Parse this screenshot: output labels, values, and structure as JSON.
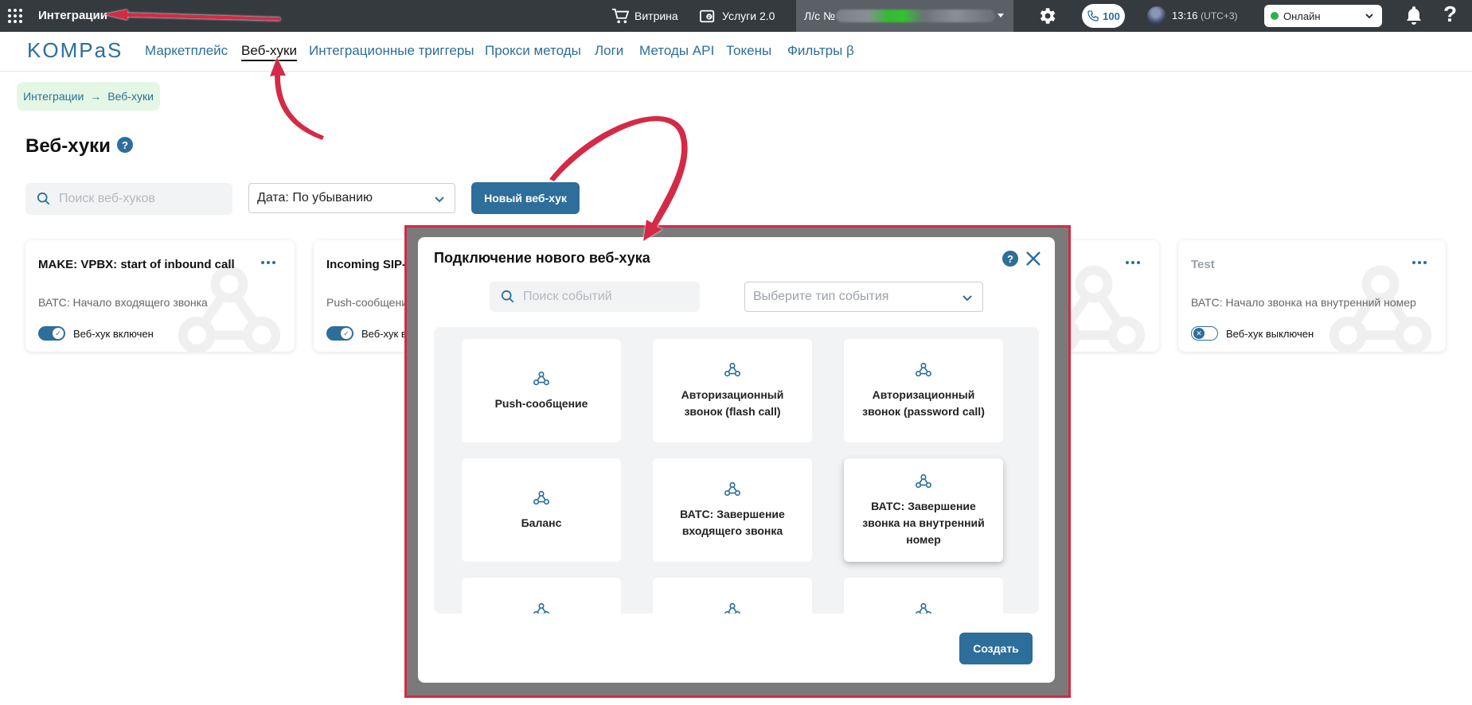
{
  "topbar": {
    "app_title": "Интеграции",
    "storefront_label": "Витрина",
    "services_label": "Услуги 2.0",
    "account_label": "Л/с №",
    "calls_count": "100",
    "time": "13:16",
    "timezone": "(UTC+3)",
    "status": "Онлайн",
    "help_label": "?"
  },
  "nav": {
    "logo": "KOMPaS",
    "links": [
      "Маркетплейс",
      "Веб-хуки",
      "Интеграционные триггеры",
      "Прокси методы",
      "Логи",
      "Методы API",
      "Токены",
      "Фильтры β"
    ],
    "active": "Веб-хуки"
  },
  "breadcrumb": {
    "parent": "Интеграции",
    "separator": "→",
    "current": "Веб-хуки"
  },
  "page": {
    "title": "Веб-хуки",
    "help_label": "?",
    "search_placeholder": "Поиск веб-хуков",
    "sort_label": "Дата: По убыванию",
    "new_button": "Новый веб-хук"
  },
  "webhooks": [
    {
      "title": "MAKE: VPBX: start of inbound call",
      "event": "ВАТС: Начало входящего звонка",
      "enabled": true,
      "status_label": "Веб-хук включен"
    },
    {
      "title": "Incoming SIP-C",
      "event": "Push-сообщение",
      "enabled": true,
      "status_label": "Веб-хук вкл"
    },
    {
      "title": "",
      "event": "",
      "enabled": true,
      "status_label": ""
    },
    {
      "title": "Test",
      "event": "ВАТС: Начало звонка на внутренний номер",
      "enabled": false,
      "status_label": "Веб-хук выключен"
    }
  ],
  "modal": {
    "title": "Подключение нового веб-хука",
    "help_label": "?",
    "search_placeholder": "Поиск событий",
    "type_placeholder": "Выберите тип события",
    "events": [
      "Push-сообщение",
      "Авторизационный звонок (flash call)",
      "Авторизационный звонок (password call)",
      "Баланс",
      "ВАТС: Завершение входящего звонка",
      "ВАТС: Завершение звонка на внутренний номер",
      "",
      "",
      ""
    ],
    "create_button": "Создать"
  },
  "colors": {
    "accent": "#2d6e9a",
    "topbar": "#353a3f",
    "online": "#2bb34b",
    "annotation": "#d42a46"
  }
}
